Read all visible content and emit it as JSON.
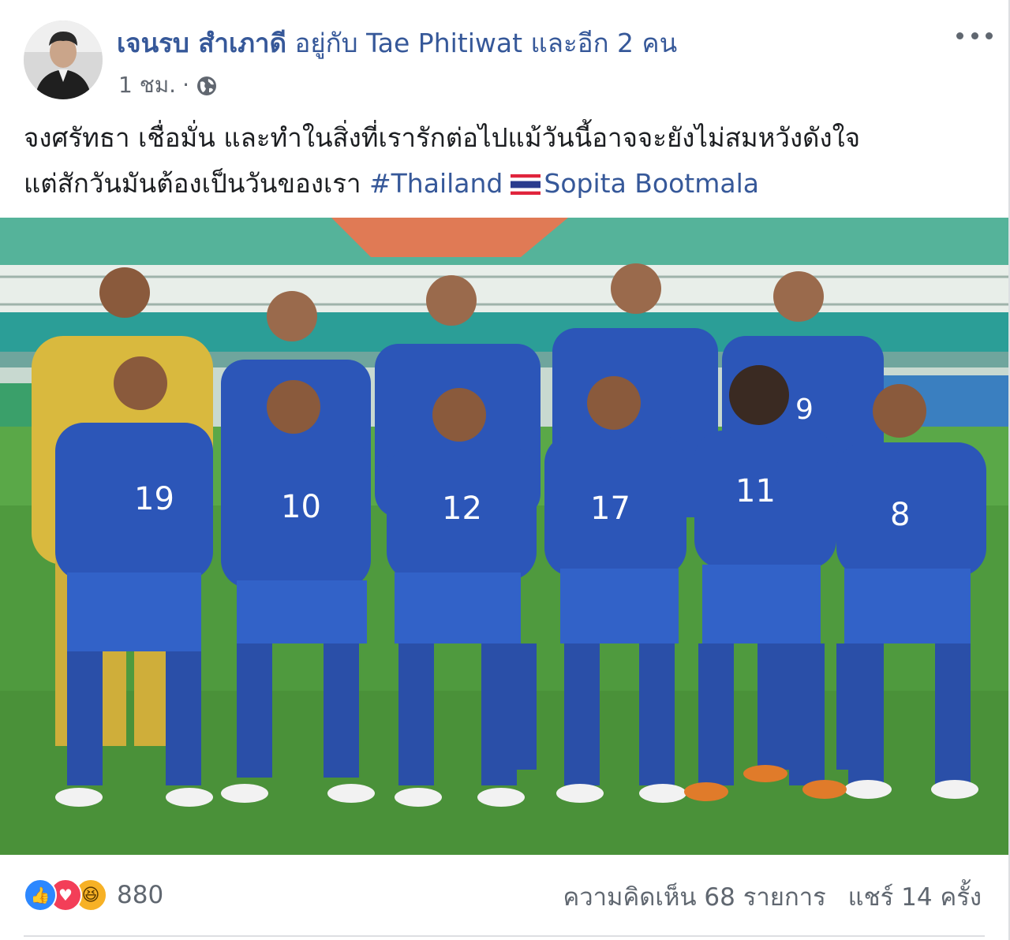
{
  "header": {
    "author": "เจนรบ สำเภาดี",
    "with_text": "อยู่กับ",
    "tagged": "Tae Phitiwat และอีก 2 คน",
    "timestamp": "1 ชม.",
    "separator": "·",
    "privacy_icon": "globe-icon",
    "menu_icon": "more-options-icon"
  },
  "post": {
    "line1": "จงศรัทธา เชื่อมั่น และทำในสิ่งที่เรารักต่อไปแม้วันนี้อาจจะยังไม่สมหวังดังใจ",
    "line2": "แต่สักวันมันต้องเป็นวันของเรา",
    "hashtag": "#Thailand",
    "flag_icon": "thailand-flag-icon",
    "mention": "Sopita Bootmala"
  },
  "photo": {
    "shirt_numbers_back": [
      "9"
    ],
    "shirt_numbers_front": [
      "19",
      "10",
      "12",
      "17",
      "11",
      "8"
    ]
  },
  "footer": {
    "reaction_icons": [
      "like-icon",
      "love-icon",
      "haha-icon"
    ],
    "reaction_count": "880",
    "comments": "ความคิดเห็น 68 รายการ",
    "shares": "แชร์ 14 ครั้ง"
  },
  "colors": {
    "link": "#365899",
    "jersey": "#2c56b8",
    "pitch": "#4f9a3e",
    "like": "#2d88ff",
    "love": "#f33e58",
    "haha": "#f7b125"
  }
}
